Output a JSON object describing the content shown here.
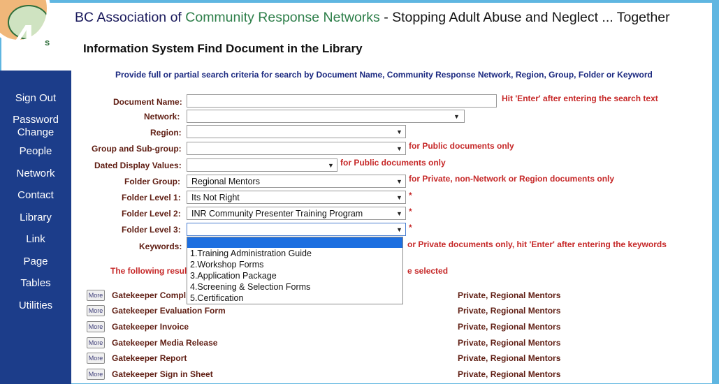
{
  "banner": {
    "prefix": "BC Association of",
    "green": "Community Response Networks",
    "tagline": "- Stopping Adult Abuse and Neglect ... Together"
  },
  "logo": {
    "step_number": "4",
    "letter": "s"
  },
  "subtitle": "Information System Find Document in the Library",
  "instructions": "Provide full or partial search criteria for search by Document Name, Community Response Network, Region, Group, Folder or Keyword",
  "sidebar": {
    "items": [
      {
        "label": "Sign Out"
      },
      {
        "label": "Password Change"
      },
      {
        "label": "People"
      },
      {
        "label": "Network"
      },
      {
        "label": "Contact"
      },
      {
        "label": "Library"
      },
      {
        "label": "Link"
      },
      {
        "label": "Page"
      },
      {
        "label": "Tables"
      },
      {
        "label": "Utilities"
      }
    ]
  },
  "form": {
    "document_name": {
      "label": "Document Name:",
      "value": "",
      "note": "Hit 'Enter' after entering the search text"
    },
    "network": {
      "label": "Network:",
      "value": ""
    },
    "region": {
      "label": "Region:",
      "value": ""
    },
    "group": {
      "label": "Group and Sub-group:",
      "value": "",
      "note": "for Public documents only"
    },
    "dated": {
      "label": "Dated Display Values:",
      "value": "",
      "note": "for Public documents only"
    },
    "folder_group": {
      "label": "Folder Group:",
      "value": "Regional Mentors",
      "note": "for Private, non-Network or Region documents only"
    },
    "folder_level1": {
      "label": "Folder Level 1:",
      "value": "Its Not Right",
      "note": "*"
    },
    "folder_level2": {
      "label": "Folder Level 2:",
      "value": "INR Community Presenter Training Program",
      "note": "*"
    },
    "folder_level3": {
      "label": "Folder Level 3:",
      "value": "",
      "note": "*"
    },
    "keywords": {
      "label": "Keywords:",
      "note": "or Private documents only, hit 'Enter' after entering the keywords"
    }
  },
  "dropdown_options": [
    "1.Training Administration Guide",
    "2.Workshop Forms",
    "3.Application Package",
    "4.Screening & Selection Forms",
    "5.Certification"
  ],
  "results": {
    "intro_left": "The following result",
    "intro_right": "e selected",
    "more_label": "More",
    "rows": [
      {
        "name": "Gatekeeper Compl",
        "access": "Private, Regional Mentors"
      },
      {
        "name": "Gatekeeper Evaluation Form",
        "access": "Private, Regional Mentors"
      },
      {
        "name": "Gatekeeper Invoice",
        "access": "Private, Regional Mentors"
      },
      {
        "name": "Gatekeeper Media Release",
        "access": "Private, Regional Mentors"
      },
      {
        "name": "Gatekeeper Report",
        "access": "Private, Regional Mentors"
      },
      {
        "name": "Gatekeeper Sign in Sheet",
        "access": "Private, Regional Mentors"
      }
    ]
  },
  "colors": {
    "sidebar_bg": "#1c3d8a",
    "frame": "#5fb6e1",
    "highlight": "#1d6fe0",
    "required": "#c62828",
    "label": "#5f1d12"
  }
}
